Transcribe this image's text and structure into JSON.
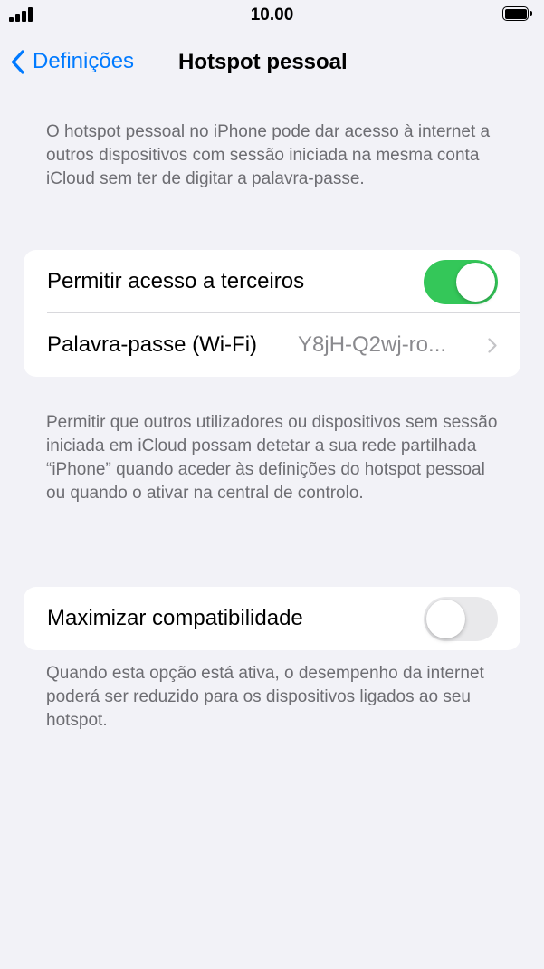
{
  "status_bar": {
    "time": "10.00",
    "signal_icon": "cellular-signal-icon",
    "battery_icon": "battery-icon",
    "battery_level": 1.0
  },
  "nav": {
    "back_label": "Definições",
    "back_icon": "chevron-left-icon",
    "title": "Hotspot pessoal"
  },
  "intro_text": "O hotspot pessoal no iPhone pode dar acesso à internet a outros dispositivos com sessão iniciada na mesma conta iCloud sem ter de digitar a palavra-passe.",
  "group1": {
    "allow_others": {
      "label": "Permitir acesso a terceiros",
      "enabled": true
    },
    "password": {
      "label": "Palavra-passe (Wi-Fi)",
      "value": "Y8jH-Q2wj-ro...",
      "chevron_icon": "chevron-right-icon"
    }
  },
  "group1_footer": "Permitir que outros utilizadores ou dispositivos sem sessão iniciada em iCloud possam detetar a sua rede partilhada “iPhone” quando aceder às definições do hotspot pessoal ou quando o ativar na central de controlo.",
  "group2": {
    "maximize_compat": {
      "label": "Maximizar compatibilidade",
      "enabled": false
    }
  },
  "group2_footer": "Quando esta opção está ativa, o desempenho da internet poderá ser reduzido para os dispositivos ligados ao seu hotspot.",
  "colors": {
    "accent": "#007aff",
    "toggle_on": "#34c759",
    "toggle_off": "#e9e9eb",
    "background": "#f2f2f7",
    "secondary_text": "#6d6d72"
  }
}
